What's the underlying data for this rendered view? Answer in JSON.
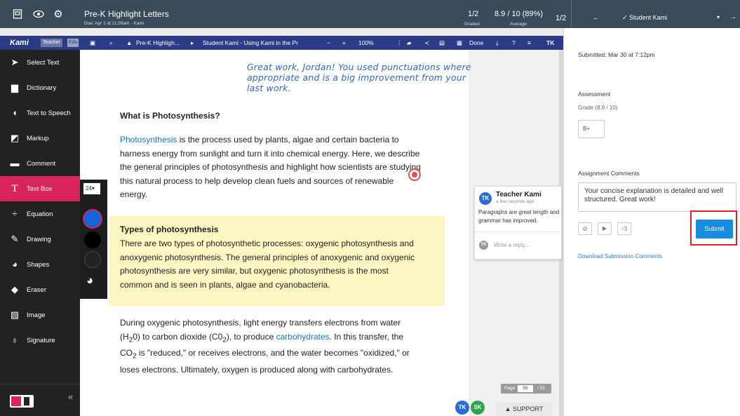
{
  "topbar": {
    "title": "Pre-K Highlight Letters",
    "due": "Due: Apr 1 at 11:59am - Kami",
    "graded_count": "1/2",
    "graded_label": "Graded",
    "average_value": "8.9 / 10 (89%)",
    "average_label": "Average",
    "page": "1/2",
    "student": "Student Kami"
  },
  "kami": {
    "logo": "Kami",
    "teacher": "Teacher",
    "edu": "Edu",
    "file": "Pre-K Highligh...",
    "student_file": "Student Kami - Using Kami in the Pr",
    "zoom": "100%",
    "done": "Done",
    "avatar": "TK"
  },
  "tools": [
    {
      "label": "Select Text",
      "icon": "cursor-icon"
    },
    {
      "label": "Dictionary",
      "icon": "book-icon"
    },
    {
      "label": "Text to Speech",
      "icon": "speech-icon"
    },
    {
      "label": "Markup",
      "icon": "markup-icon"
    },
    {
      "label": "Comment",
      "icon": "comment-icon"
    },
    {
      "label": "Text Box",
      "icon": "textbox-icon"
    },
    {
      "label": "Equation",
      "icon": "equation-icon"
    },
    {
      "label": "Drawing",
      "icon": "pen-icon"
    },
    {
      "label": "Shapes",
      "icon": "shapes-icon"
    },
    {
      "label": "Eraser",
      "icon": "eraser-icon"
    },
    {
      "label": "Image",
      "icon": "image-icon"
    },
    {
      "label": "Signature",
      "icon": "signature-icon"
    }
  ],
  "font_size": "24",
  "colors": {
    "blue": "#1565d8",
    "black": "#000000",
    "dark": "#222222",
    "accent": "#d7245c"
  },
  "document": {
    "handwritten": "Great work, Jordan! You used punctuations where appropriate and is a big improvement from your last work.",
    "heading1": "What is Photosynthesis?",
    "p1_link": "Photosynthesis",
    "p1": " is the process used by plants, algae and certain bacteria to harness energy from sunlight and turn it into chemical energy. Here, we describe the general principles of photosynthesis and highlight how scientists are studying this natural process to help develop clean fuels and sources of renewable energy.",
    "heading2": "Types of photosynthesis",
    "p2": "There are two types of photosynthetic processes: oxygenic photosynthesis and anoxygenic photosynthesis. The general principles of anoxygenic and oxygenic photosynthesis are very similar, but oxygenic photosynthesis is the most common and is seen in plants, algae and cyanobacteria.",
    "p3a": "During oxygenic photosynthesis, light energy transfers electrons from water (H",
    "p3b": "2",
    "p3c": "0) to carbon dioxide (C0",
    "p3d": "2",
    "p3e": "), to produce ",
    "p3_link": "carbohydrates",
    "p3f": ". In this transfer, the CO",
    "p3g": "2",
    "p3h": " is \"reduced,\" or receives electrons, and the water becomes \"oxidized,\" or loses electrons. Ultimately, oxygen is produced along with carbohydrates."
  },
  "comment": {
    "avatar": "TK",
    "author": "Teacher Kami",
    "time": "a few seconds ago",
    "text": "Paragraphs are great length and grammar has improved.",
    "reply_placeholder": "Write a reply..."
  },
  "pager": {
    "label": "Page",
    "current": "55",
    "total": "/ 55"
  },
  "bottom_avatars": [
    "TK",
    "SK"
  ],
  "support": "SUPPORT",
  "right": {
    "submitted": "Submitted: Mar 30 at 7:12pm",
    "assessment_heading": "Assessment",
    "grade_label": "Grade (8.9 / 10)",
    "grade_value": "B+",
    "comments_heading": "Assignment Comments",
    "comment_text": "Your concise explanation is detailed and well structured. Great work!",
    "submit": "Submit",
    "download": "Download Submission Comments"
  }
}
